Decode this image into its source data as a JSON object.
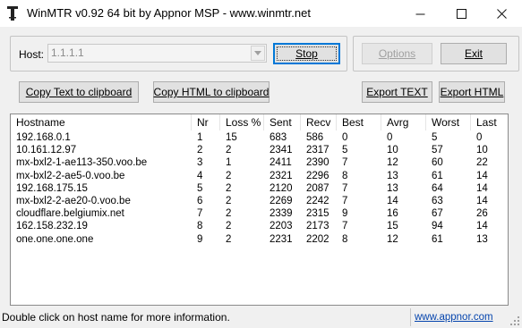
{
  "window": {
    "title": "WinMTR v0.92 64 bit by Appnor MSP - www.winmtr.net",
    "controls": {
      "minimize": "—",
      "maximize": "☐",
      "close": "✕"
    }
  },
  "host": {
    "label": "Host:",
    "value": "1.1.1.1"
  },
  "buttons": {
    "stop": "Stop",
    "options": "Options",
    "exit": "Exit",
    "copy_text": "Copy Text to clipboard",
    "copy_html": "Copy HTML to clipboard",
    "export_text": "Export TEXT",
    "export_html": "Export HTML"
  },
  "table": {
    "headers": [
      "Hostname",
      "Nr",
      "Loss %",
      "Sent",
      "Recv",
      "Best",
      "Avrg",
      "Worst",
      "Last"
    ],
    "rows": [
      [
        "192.168.0.1",
        "1",
        "15",
        "683",
        "586",
        "0",
        "0",
        "5",
        "0"
      ],
      [
        "10.161.12.97",
        "2",
        "2",
        "2341",
        "2317",
        "5",
        "10",
        "57",
        "10"
      ],
      [
        "mx-bxl2-1-ae113-350.voo.be",
        "3",
        "1",
        "2411",
        "2390",
        "7",
        "12",
        "60",
        "22"
      ],
      [
        "mx-bxl2-2-ae5-0.voo.be",
        "4",
        "2",
        "2321",
        "2296",
        "8",
        "13",
        "61",
        "14"
      ],
      [
        "192.168.175.15",
        "5",
        "2",
        "2120",
        "2087",
        "7",
        "13",
        "64",
        "14"
      ],
      [
        "mx-bxl2-2-ae20-0.voo.be",
        "6",
        "2",
        "2269",
        "2242",
        "7",
        "14",
        "63",
        "14"
      ],
      [
        "cloudflare.belgiumix.net",
        "7",
        "2",
        "2339",
        "2315",
        "9",
        "16",
        "67",
        "26"
      ],
      [
        "162.158.232.19",
        "8",
        "2",
        "2203",
        "2173",
        "7",
        "15",
        "94",
        "14"
      ],
      [
        "one.one.one.one",
        "9",
        "2",
        "2231",
        "2202",
        "8",
        "12",
        "61",
        "13"
      ]
    ]
  },
  "status": {
    "message": "Double click on host name for more information.",
    "link": "www.appnor.com"
  }
}
